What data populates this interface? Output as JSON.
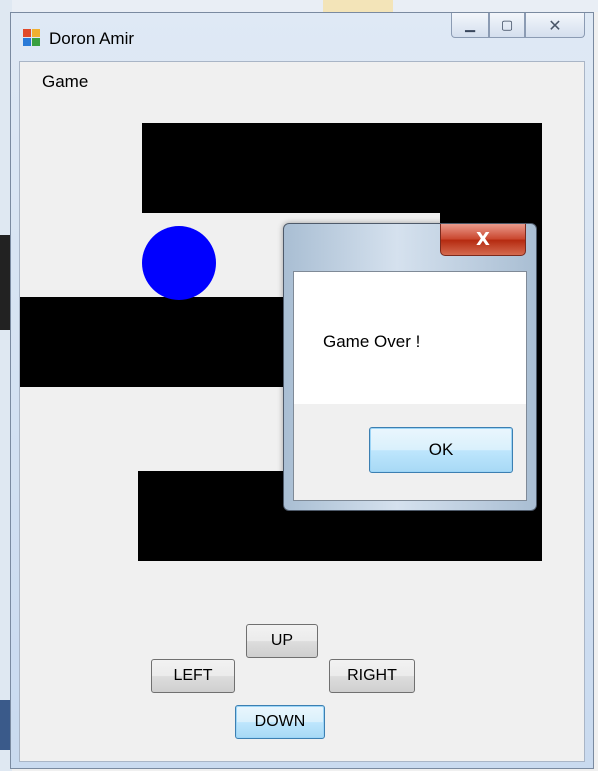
{
  "window": {
    "title": "Doron Amir",
    "minimize_glyph": "▁",
    "maximize_glyph": "▢",
    "close_glyph": "✕"
  },
  "menu": {
    "items": [
      {
        "label": "Game"
      }
    ]
  },
  "game": {
    "wall_color": "#000000",
    "ball_color": "#0000ff",
    "controls": {
      "up": "UP",
      "left": "LEFT",
      "right": "RIGHT",
      "down": "DOWN"
    }
  },
  "dialog": {
    "message": "Game Over !",
    "ok_label": "OK",
    "close_glyph": "X"
  }
}
